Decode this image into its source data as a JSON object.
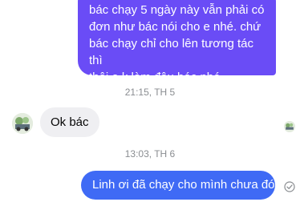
{
  "messages": [
    {
      "direction": "outgoing",
      "lines": [
        "bác chạy 5 ngày này vẫn phải có",
        "đơn như bác nói cho e nhé. chứ",
        "bác chạy chỉ cho lên tương tác thì",
        "thôi e k làm đâu bác nhé."
      ],
      "color": "#6a4cf6"
    },
    {
      "direction": "timestamp",
      "text": "21:15, TH 5"
    },
    {
      "direction": "incoming",
      "text": "Ok bác",
      "avatar_icon": "contact-avatar"
    },
    {
      "direction": "timestamp",
      "text": "13:03, TH 6"
    },
    {
      "direction": "outgoing",
      "text": "Linh ơi đã chạy cho mình chưa đó",
      "color": "#3f6af5",
      "status_icon": "sent-check-icon"
    }
  ],
  "colors": {
    "background": "#ffffff",
    "incoming_bubble": "#efeff2",
    "timestamp_text": "#8a8d91"
  }
}
